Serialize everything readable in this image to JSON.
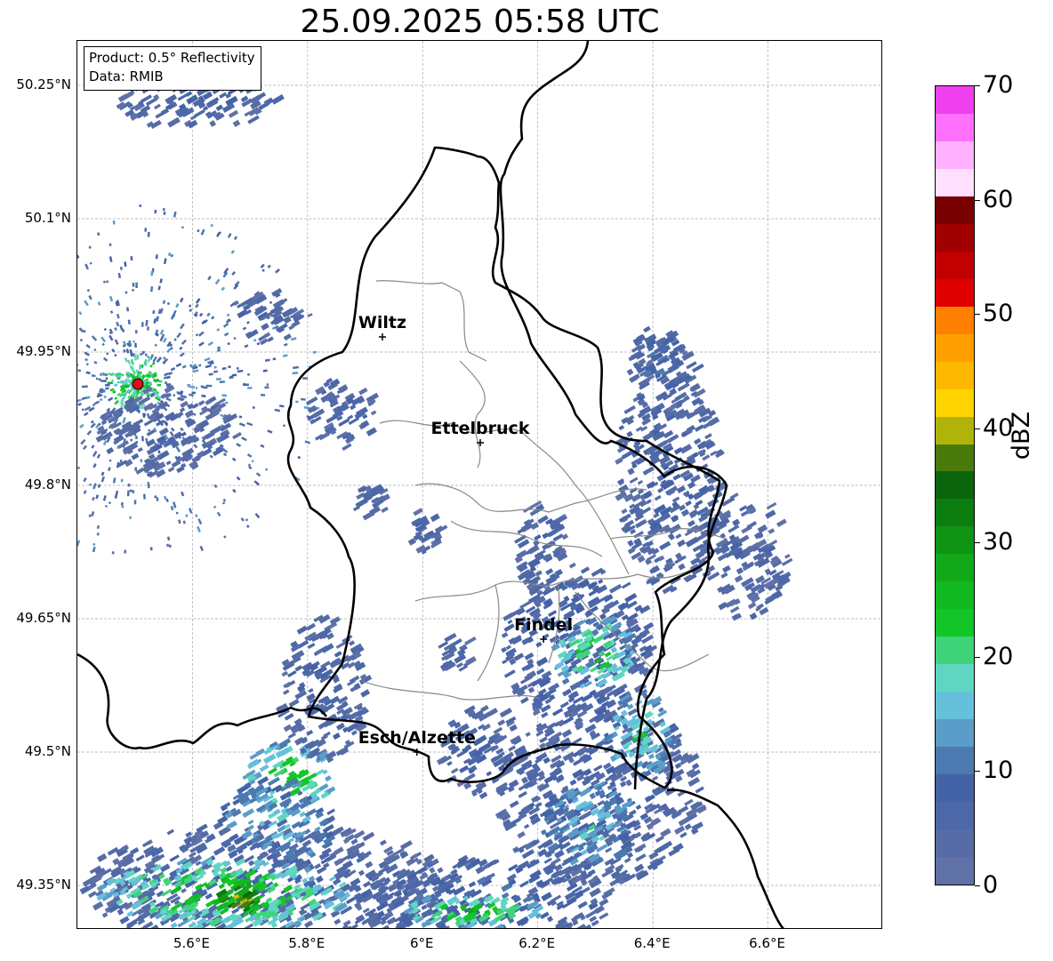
{
  "title": "25.09.2025 05:58 UTC",
  "info": {
    "product": "Product: 0.5° Reflectivity",
    "source": "Data: RMIB"
  },
  "axes": {
    "lat_ticks": [
      "50.25°N",
      "50.1°N",
      "49.95°N",
      "49.8°N",
      "49.65°N",
      "49.5°N",
      "49.35°N"
    ],
    "lat_values": [
      50.25,
      50.1,
      49.95,
      49.8,
      49.65,
      49.5,
      49.35
    ],
    "lon_ticks": [
      "5.6°E",
      "5.8°E",
      "6°E",
      "6.2°E",
      "6.4°E",
      "6.6°E"
    ],
    "lon_values": [
      5.6,
      5.8,
      6.0,
      6.2,
      6.4,
      6.6
    ],
    "lon_range": [
      5.4,
      6.8
    ],
    "lat_range": [
      49.3,
      50.3
    ],
    "grid": true
  },
  "cities": [
    {
      "name": "Wiltz",
      "lon": 5.93,
      "lat": 49.967
    },
    {
      "name": "Ettelbruck",
      "lon": 6.1,
      "lat": 49.848
    },
    {
      "name": "Findel",
      "lon": 6.21,
      "lat": 49.627
    },
    {
      "name": "Esch/Alzette",
      "lon": 5.99,
      "lat": 49.5
    }
  ],
  "radar_site": {
    "lon": 5.505,
    "lat": 49.914,
    "color": "#e01010"
  },
  "colorbar": {
    "label": "dBZ",
    "ticks": [
      "0",
      "10",
      "20",
      "30",
      "40",
      "50",
      "60",
      "70"
    ],
    "tick_values": [
      0,
      10,
      20,
      30,
      40,
      50,
      60,
      70
    ],
    "min": 0,
    "max": 70,
    "colors": [
      "#6071a8",
      "#566ca6",
      "#4d68a8",
      "#4462a6",
      "#4b79b0",
      "#5a9dc8",
      "#66c0db",
      "#5fd6c2",
      "#3fd47a",
      "#12c628",
      "#12b820",
      "#12a81a",
      "#0f9414",
      "#0c7d10",
      "#0a650c",
      "#4a7a0c",
      "#b0b40a",
      "#ffd400",
      "#ffb800",
      "#ffa000",
      "#ff8000",
      "#e00000",
      "#c20000",
      "#a00000",
      "#780000",
      "#ffe0ff",
      "#ffb0ff",
      "#ff70ff",
      "#ee40ee"
    ]
  },
  "echoes": [
    {
      "lon": 5.72,
      "lat": 49.35,
      "rx": 0.32,
      "ry": 0.07,
      "dbz": 6
    },
    {
      "lon": 5.65,
      "lat": 49.34,
      "rx": 0.22,
      "ry": 0.04,
      "dbz": 24
    },
    {
      "lon": 5.67,
      "lat": 49.335,
      "rx": 0.04,
      "ry": 0.02,
      "dbz": 40
    },
    {
      "lon": 5.76,
      "lat": 49.47,
      "rx": 0.08,
      "ry": 0.04,
      "dbz": 22
    },
    {
      "lon": 5.74,
      "lat": 49.42,
      "rx": 0.1,
      "ry": 0.05,
      "dbz": 14
    },
    {
      "lon": 6.1,
      "lat": 49.33,
      "rx": 0.22,
      "ry": 0.05,
      "dbz": 8
    },
    {
      "lon": 6.08,
      "lat": 49.32,
      "rx": 0.12,
      "ry": 0.02,
      "dbz": 24
    },
    {
      "lon": 6.3,
      "lat": 49.45,
      "rx": 0.18,
      "ry": 0.1,
      "dbz": 6
    },
    {
      "lon": 6.28,
      "lat": 49.42,
      "rx": 0.08,
      "ry": 0.05,
      "dbz": 16
    },
    {
      "lon": 6.26,
      "lat": 49.62,
      "rx": 0.13,
      "ry": 0.09,
      "dbz": 8
    },
    {
      "lon": 6.29,
      "lat": 49.61,
      "rx": 0.07,
      "ry": 0.04,
      "dbz": 22
    },
    {
      "lon": 6.37,
      "lat": 49.52,
      "rx": 0.06,
      "ry": 0.05,
      "dbz": 18
    },
    {
      "lon": 6.1,
      "lat": 49.5,
      "rx": 0.08,
      "ry": 0.05,
      "dbz": 6
    },
    {
      "lon": 6.42,
      "lat": 49.82,
      "rx": 0.09,
      "ry": 0.14,
      "dbz": 6
    },
    {
      "lon": 6.4,
      "lat": 49.93,
      "rx": 0.05,
      "ry": 0.05,
      "dbz": 8
    },
    {
      "lon": 6.55,
      "lat": 49.72,
      "rx": 0.08,
      "ry": 0.07,
      "dbz": 5
    },
    {
      "lon": 6.2,
      "lat": 49.73,
      "rx": 0.05,
      "ry": 0.05,
      "dbz": 6
    },
    {
      "lon": 5.82,
      "lat": 49.57,
      "rx": 0.08,
      "ry": 0.08,
      "dbz": 6
    },
    {
      "lon": 5.9,
      "lat": 49.78,
      "rx": 0.03,
      "ry": 0.02,
      "dbz": 6
    },
    {
      "lon": 6.0,
      "lat": 49.75,
      "rx": 0.03,
      "ry": 0.025,
      "dbz": 6
    },
    {
      "lon": 6.05,
      "lat": 49.61,
      "rx": 0.03,
      "ry": 0.02,
      "dbz": 6
    },
    {
      "lon": 5.6,
      "lat": 50.23,
      "rx": 0.14,
      "ry": 0.03,
      "dbz": 6
    },
    {
      "lon": 5.55,
      "lat": 49.86,
      "rx": 0.12,
      "ry": 0.05,
      "dbz": 5
    },
    {
      "lon": 5.72,
      "lat": 49.99,
      "rx": 0.06,
      "ry": 0.03,
      "dbz": 6
    },
    {
      "lon": 5.85,
      "lat": 49.88,
      "rx": 0.06,
      "ry": 0.04,
      "dbz": 6
    }
  ]
}
